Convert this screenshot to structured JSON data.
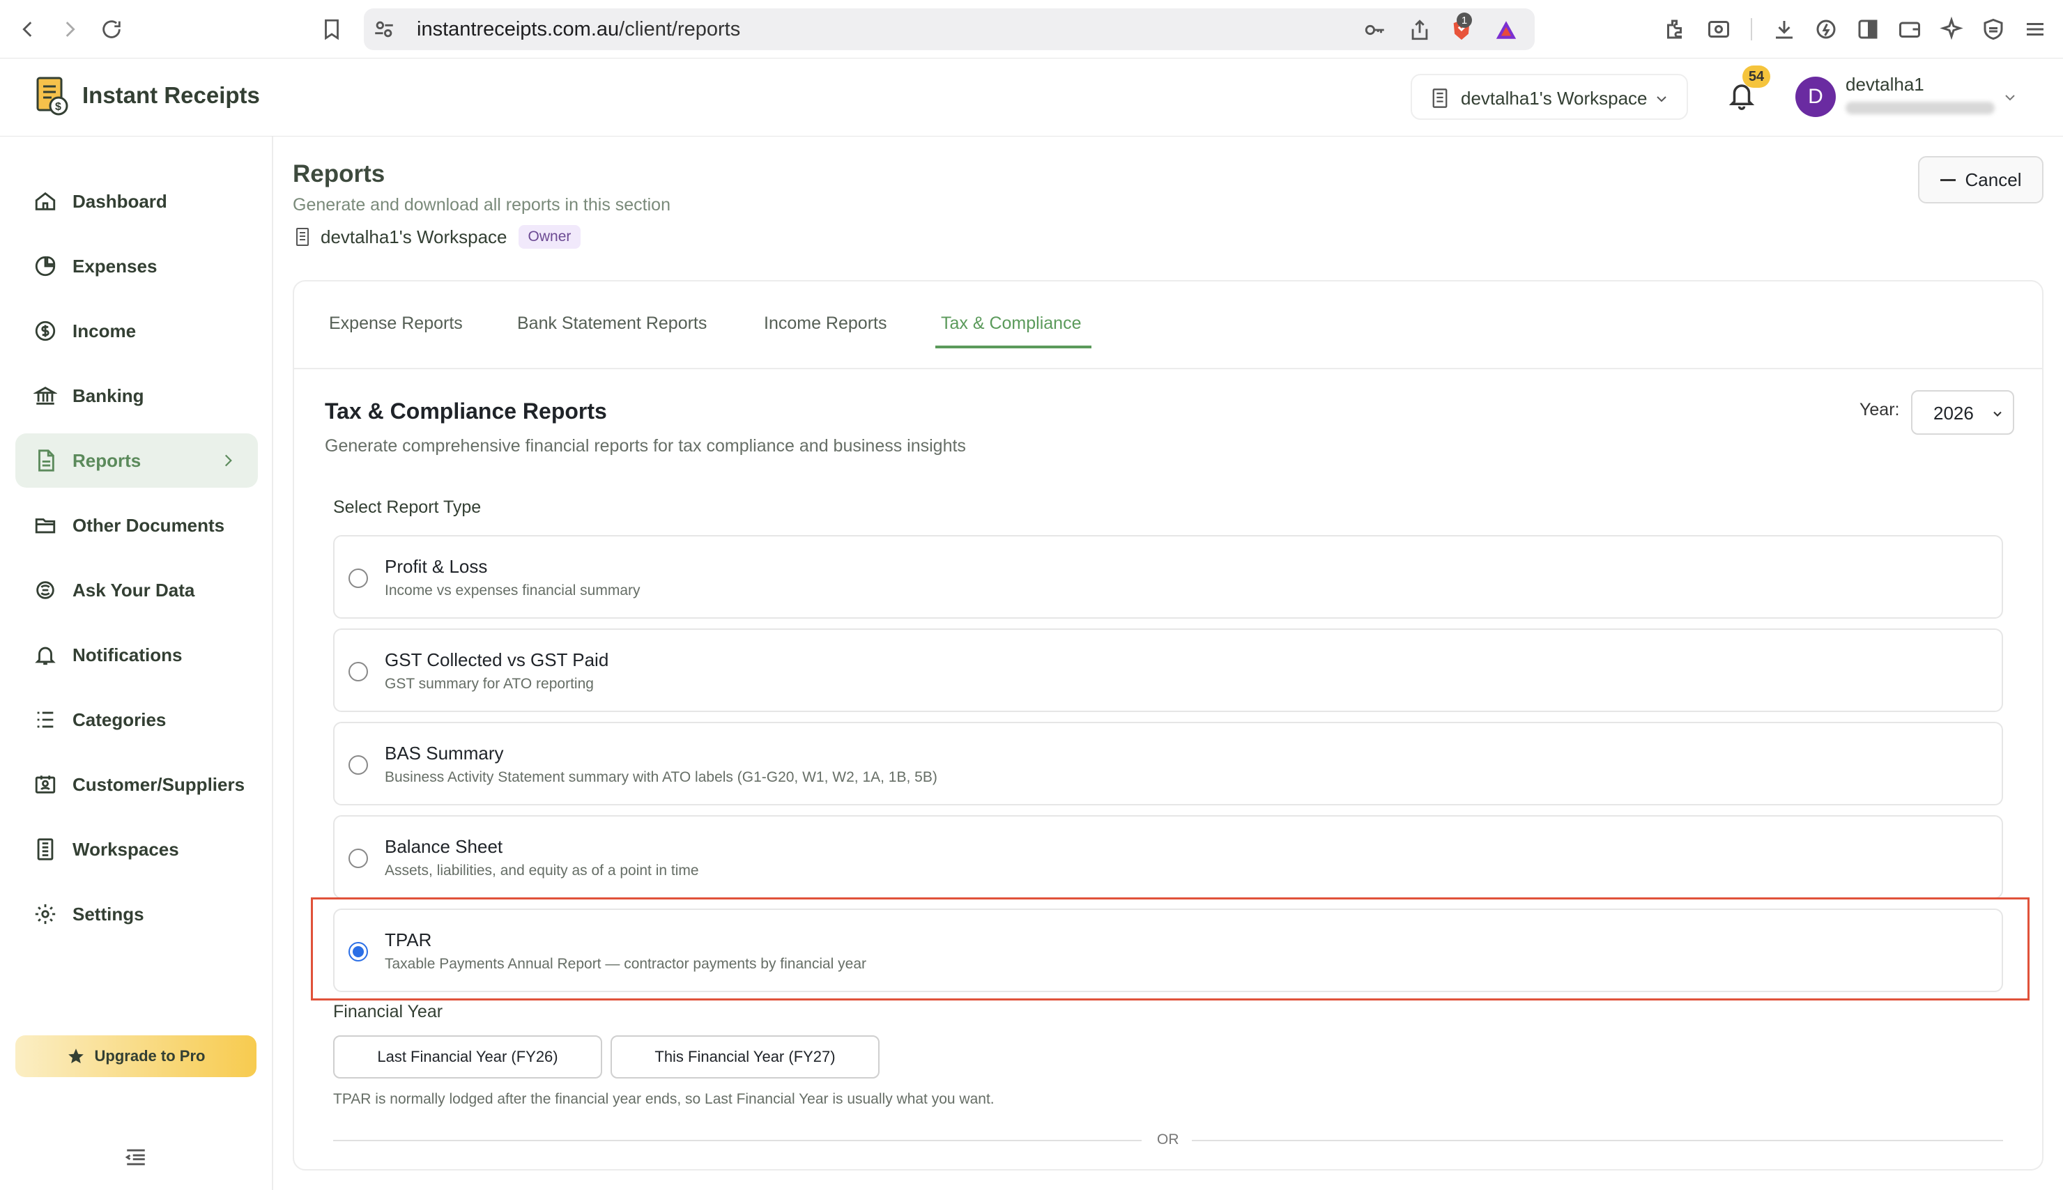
{
  "browser": {
    "url_domain": "instantreceipts.com.au",
    "url_path": "/client/reports",
    "brave_count": "1"
  },
  "header": {
    "brand": "Instant Receipts",
    "workspace": "devtalha1's Workspace",
    "notifications_count": "54",
    "user_initial": "D",
    "user_name": "devtalha1"
  },
  "sidebar": {
    "items": [
      {
        "label": "Dashboard",
        "icon": "home-icon"
      },
      {
        "label": "Expenses",
        "icon": "pie-chart-icon"
      },
      {
        "label": "Income",
        "icon": "dollar-circle-icon"
      },
      {
        "label": "Banking",
        "icon": "bank-icon"
      },
      {
        "label": "Reports",
        "icon": "file-icon",
        "active": true
      },
      {
        "label": "Other Documents",
        "icon": "folder-icon"
      },
      {
        "label": "Ask Your Data",
        "icon": "ai-icon"
      },
      {
        "label": "Notifications",
        "icon": "bell-icon"
      },
      {
        "label": "Categories",
        "icon": "list-icon"
      },
      {
        "label": "Customer/Suppliers",
        "icon": "contacts-icon"
      },
      {
        "label": "Workspaces",
        "icon": "building-icon"
      },
      {
        "label": "Settings",
        "icon": "gear-icon"
      }
    ],
    "upgrade_label": "Upgrade to Pro"
  },
  "page": {
    "title": "Reports",
    "subtitle": "Generate and download all reports in this section",
    "workspace": "devtalha1's Workspace",
    "role": "Owner",
    "cancel_label": "Cancel"
  },
  "tabs": [
    {
      "label": "Expense Reports"
    },
    {
      "label": "Bank Statement Reports"
    },
    {
      "label": "Income Reports"
    },
    {
      "label": "Tax & Compliance",
      "active": true
    }
  ],
  "section": {
    "title": "Tax & Compliance Reports",
    "subtitle": "Generate comprehensive financial reports for tax compliance and business insights",
    "year_label": "Year:",
    "year_value": "2026",
    "select_label": "Select Report Type"
  },
  "report_types": [
    {
      "title": "Profit & Loss",
      "desc": "Income vs expenses financial summary",
      "selected": false
    },
    {
      "title": "GST Collected vs GST Paid",
      "desc": "GST summary for ATO reporting",
      "selected": false
    },
    {
      "title": "BAS Summary",
      "desc": "Business Activity Statement summary with ATO labels (G1-G20, W1, W2, 1A, 1B, 5B)",
      "selected": false
    },
    {
      "title": "Balance Sheet",
      "desc": "Assets, liabilities, and equity as of a point in time",
      "selected": false
    },
    {
      "title": "TPAR",
      "desc": "Taxable Payments Annual Report — contractor payments by financial year",
      "selected": true
    }
  ],
  "financial_year": {
    "label": "Financial Year",
    "last_label": "Last Financial Year (FY26)",
    "this_label": "This Financial Year (FY27)",
    "note": "TPAR is normally lodged after the financial year ends, so Last Financial Year is usually what you want.",
    "or_label": "OR"
  },
  "colors": {
    "accent_green": "#5b9a5b",
    "radio_blue": "#2b6fe6",
    "highlight_red": "#e0523a",
    "badge_yellow": "#f5c43c",
    "avatar_purple": "#6a2ba1"
  }
}
